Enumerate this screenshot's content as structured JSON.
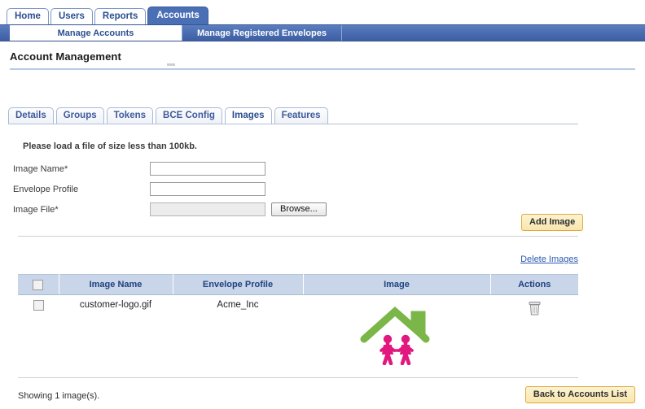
{
  "topnav": {
    "tabs": [
      {
        "label": "Home",
        "active": false
      },
      {
        "label": "Users",
        "active": false
      },
      {
        "label": "Reports",
        "active": false
      },
      {
        "label": "Accounts",
        "active": true
      }
    ]
  },
  "subnav": {
    "tabs": [
      {
        "label": "Manage Accounts",
        "active": true
      },
      {
        "label": "Manage Registered Envelopes",
        "active": false
      }
    ]
  },
  "page": {
    "title": "Account Management"
  },
  "content_tabs": [
    {
      "label": "Details",
      "active": false
    },
    {
      "label": "Groups",
      "active": false
    },
    {
      "label": "Tokens",
      "active": false
    },
    {
      "label": "BCE Config",
      "active": false
    },
    {
      "label": "Images",
      "active": true
    },
    {
      "label": "Features",
      "active": false
    }
  ],
  "form": {
    "hint": "Please load a file of size less than 100kb.",
    "fields": [
      {
        "label": "Image Name*",
        "value": "",
        "placeholder": "",
        "disabled": false
      },
      {
        "label": "Envelope Profile",
        "value": "",
        "placeholder": "",
        "disabled": false
      },
      {
        "label": "Image File*",
        "value": "",
        "placeholder": "",
        "disabled": true
      }
    ],
    "browse_label": "Browse...",
    "add_image_label": "Add Image"
  },
  "table": {
    "delete_link": "Delete Images",
    "columns": [
      "",
      "Image Name",
      "Envelope Profile",
      "Image",
      "Actions"
    ],
    "rows": [
      {
        "selected": false,
        "image_name": "customer-logo.gif",
        "envelope_profile": "Acme_Inc",
        "image_alt": "house-family-logo",
        "action_icon": "trash-icon"
      }
    ]
  },
  "footer": {
    "showing": "Showing 1 image(s).",
    "back_label": "Back to Accounts List"
  },
  "colors": {
    "nav_blue": "#4a6fb5",
    "sub_bar_blue": "#4a6cb0",
    "tab_text_blue": "#2b4f90",
    "table_header_bg": "#c9d5e9",
    "table_header_text": "#21417e",
    "link_blue": "#2b5ab0",
    "button_yellow_bg": "#f8e6ac",
    "button_yellow_border": "#e0a93a",
    "logo_green": "#7ab648",
    "logo_pink": "#e2187f",
    "trash_grey": "#9a9a9a"
  }
}
